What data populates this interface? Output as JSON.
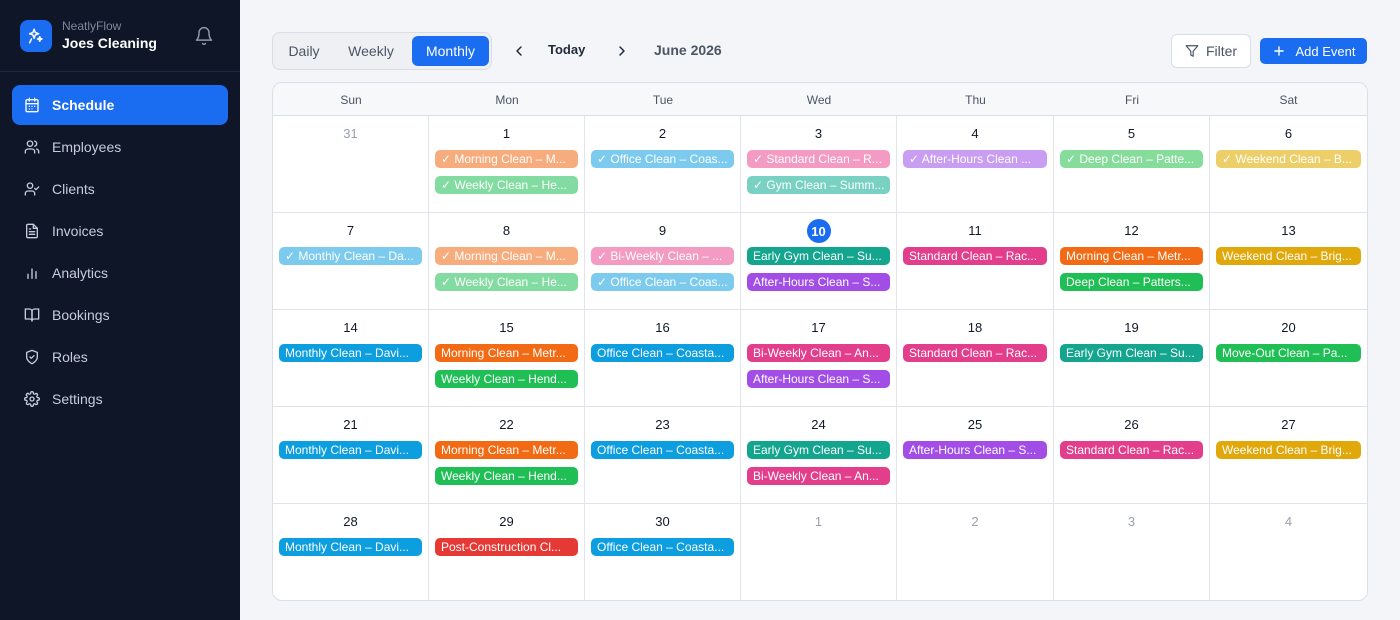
{
  "app": {
    "name": "NeatlyFlow",
    "company": "Joes Cleaning"
  },
  "colors": {
    "accent": "#1a6cf0",
    "sidebar_bg": "#0e1628"
  },
  "sidebar": {
    "items": [
      {
        "label": "Schedule",
        "icon": "calendar-icon",
        "active": true
      },
      {
        "label": "Employees",
        "icon": "users-icon"
      },
      {
        "label": "Clients",
        "icon": "user-check-icon"
      },
      {
        "label": "Invoices",
        "icon": "file-text-icon"
      },
      {
        "label": "Analytics",
        "icon": "bar-chart-icon"
      },
      {
        "label": "Bookings",
        "icon": "book-open-icon"
      },
      {
        "label": "Roles",
        "icon": "shield-icon"
      },
      {
        "label": "Settings",
        "icon": "gear-icon"
      }
    ]
  },
  "toolbar": {
    "views": [
      "Daily",
      "Weekly",
      "Monthly"
    ],
    "active_view": "Monthly",
    "today_label": "Today",
    "month_label": "June 2026",
    "filter_label": "Filter",
    "add_label": "Add Event"
  },
  "calendar": {
    "weekdays": [
      "Sun",
      "Mon",
      "Tue",
      "Wed",
      "Thu",
      "Fri",
      "Sat"
    ],
    "today": 10,
    "weeks": [
      [
        {
          "day": "31",
          "muted": true,
          "events": []
        },
        {
          "day": "1",
          "events": [
            {
              "t": "✓ Morning Clean – M...",
              "c": "#f7ac7e"
            },
            {
              "t": "✓ Weekly Clean – He...",
              "c": "#82dba0"
            }
          ]
        },
        {
          "day": "2",
          "events": [
            {
              "t": "✓ Office Clean – Coas...",
              "c": "#7ccaed"
            }
          ]
        },
        {
          "day": "3",
          "events": [
            {
              "t": "✓ Standard Clean – R...",
              "c": "#f39bc3"
            },
            {
              "t": "✓ Gym Clean – Summ...",
              "c": "#78d1c2"
            }
          ]
        },
        {
          "day": "4",
          "events": [
            {
              "t": "✓ After-Hours Clean ...",
              "c": "#c89df2"
            }
          ]
        },
        {
          "day": "5",
          "events": [
            {
              "t": "✓ Deep Clean – Patte...",
              "c": "#86dc9b"
            }
          ]
        },
        {
          "day": "6",
          "events": [
            {
              "t": "✓ Weekend Clean – B...",
              "c": "#edcf6a"
            }
          ]
        }
      ],
      [
        {
          "day": "7",
          "events": [
            {
              "t": "✓ Monthly Clean – Da...",
              "c": "#7ccaed"
            }
          ]
        },
        {
          "day": "8",
          "events": [
            {
              "t": "✓ Morning Clean – M...",
              "c": "#f7ac7e"
            },
            {
              "t": "✓ Weekly Clean – He...",
              "c": "#82dba0"
            }
          ]
        },
        {
          "day": "9",
          "events": [
            {
              "t": "✓ Bi-Weekly Clean – ...",
              "c": "#f39bc3"
            },
            {
              "t": "✓ Office Clean – Coas...",
              "c": "#7ccaed"
            }
          ]
        },
        {
          "day": "10",
          "events": [
            {
              "t": "Early Gym Clean – Su...",
              "c": "#14a58f"
            },
            {
              "t": "After-Hours Clean – S...",
              "c": "#a24ee6"
            }
          ]
        },
        {
          "day": "11",
          "events": [
            {
              "t": "Standard Clean – Rac...",
              "c": "#e23e8b"
            }
          ]
        },
        {
          "day": "12",
          "events": [
            {
              "t": "Morning Clean – Metr...",
              "c": "#f26b14"
            },
            {
              "t": "Deep Clean – Patters...",
              "c": "#20bf55"
            }
          ]
        },
        {
          "day": "13",
          "events": [
            {
              "t": "Weekend Clean – Brig...",
              "c": "#e0a80a"
            }
          ]
        }
      ],
      [
        {
          "day": "14",
          "events": [
            {
              "t": "Monthly Clean – Davi...",
              "c": "#0d9ee0"
            }
          ]
        },
        {
          "day": "15",
          "events": [
            {
              "t": "Morning Clean – Metr...",
              "c": "#f26b14"
            },
            {
              "t": "Weekly Clean – Hend...",
              "c": "#20bf55"
            }
          ]
        },
        {
          "day": "16",
          "events": [
            {
              "t": "Office Clean – Coasta...",
              "c": "#0d9ee0"
            }
          ]
        },
        {
          "day": "17",
          "events": [
            {
              "t": "Bi-Weekly Clean – An...",
              "c": "#e23e8b"
            },
            {
              "t": "After-Hours Clean – S...",
              "c": "#a24ee6"
            }
          ]
        },
        {
          "day": "18",
          "events": [
            {
              "t": "Standard Clean – Rac...",
              "c": "#e23e8b"
            }
          ]
        },
        {
          "day": "19",
          "events": [
            {
              "t": "Early Gym Clean – Su...",
              "c": "#14a58f"
            }
          ]
        },
        {
          "day": "20",
          "events": [
            {
              "t": "Move-Out Clean – Pa...",
              "c": "#20bf55"
            }
          ]
        }
      ],
      [
        {
          "day": "21",
          "events": [
            {
              "t": "Monthly Clean – Davi...",
              "c": "#0d9ee0"
            }
          ]
        },
        {
          "day": "22",
          "events": [
            {
              "t": "Morning Clean – Metr...",
              "c": "#f26b14"
            },
            {
              "t": "Weekly Clean – Hend...",
              "c": "#20bf55"
            }
          ]
        },
        {
          "day": "23",
          "events": [
            {
              "t": "Office Clean – Coasta...",
              "c": "#0d9ee0"
            }
          ]
        },
        {
          "day": "24",
          "events": [
            {
              "t": "Early Gym Clean – Su...",
              "c": "#14a58f"
            },
            {
              "t": "Bi-Weekly Clean – An...",
              "c": "#e23e8b"
            }
          ]
        },
        {
          "day": "25",
          "events": [
            {
              "t": "After-Hours Clean – S...",
              "c": "#a24ee6"
            }
          ]
        },
        {
          "day": "26",
          "events": [
            {
              "t": "Standard Clean – Rac...",
              "c": "#e23e8b"
            }
          ]
        },
        {
          "day": "27",
          "events": [
            {
              "t": "Weekend Clean – Brig...",
              "c": "#e0a80a"
            }
          ]
        }
      ],
      [
        {
          "day": "28",
          "events": [
            {
              "t": "Monthly Clean – Davi...",
              "c": "#0d9ee0"
            }
          ]
        },
        {
          "day": "29",
          "events": [
            {
              "t": "Post-Construction Cl...",
              "c": "#e53935"
            }
          ]
        },
        {
          "day": "30",
          "events": [
            {
              "t": "Office Clean – Coasta...",
              "c": "#0d9ee0"
            }
          ]
        },
        {
          "day": "1",
          "muted": true,
          "events": []
        },
        {
          "day": "2",
          "muted": true,
          "events": []
        },
        {
          "day": "3",
          "muted": true,
          "events": []
        },
        {
          "day": "4",
          "muted": true,
          "events": []
        }
      ]
    ]
  }
}
